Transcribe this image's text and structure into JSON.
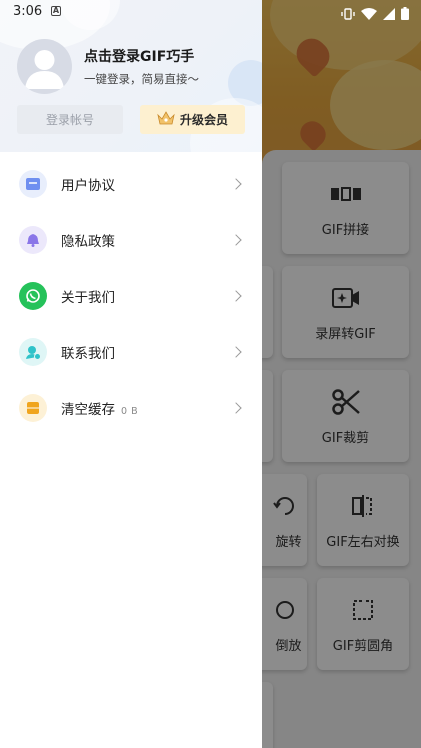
{
  "status_bar": {
    "time": "3:06",
    "icons": [
      "notification-a-icon",
      "vibrate-icon",
      "wifi-icon",
      "signal-icon",
      "battery-icon"
    ]
  },
  "drawer": {
    "profile": {
      "name": "点击登录GIF巧手",
      "subtitle": "一键登录，简易直接～",
      "login_label": "登录帐号",
      "vip_label": "升级会员"
    },
    "menu": [
      {
        "label": "用户协议",
        "icon": "document-icon",
        "extra": "",
        "color": "#6f8ff0",
        "bg": "#e8eefc"
      },
      {
        "label": "隐私政策",
        "icon": "bell-icon",
        "extra": "",
        "color": "#8a76e8",
        "bg": "#ece8fb"
      },
      {
        "label": "关于我们",
        "icon": "whatsapp-icon",
        "extra": "",
        "color": "#ffffff",
        "bg": "#25c25a"
      },
      {
        "label": "联系我们",
        "icon": "contact-icon",
        "extra": "",
        "color": "#2fc3c9",
        "bg": "#dff6f6"
      },
      {
        "label": "清空缓存",
        "icon": "trash-icon",
        "extra": "0 B",
        "color": "#f0a51e",
        "bg": "#fdf1d6"
      }
    ]
  },
  "background_app": {
    "tools": [
      {
        "label": "GIF拼接",
        "icon": "merge-icon"
      },
      {
        "label": "录屏转GIF",
        "icon": "screen-record-icon"
      },
      {
        "label": "GIF裁剪",
        "icon": "scissors-icon"
      },
      {
        "label": "旋转",
        "icon": "rotate-icon"
      },
      {
        "label": "GIF左右对换",
        "icon": "flip-horizontal-icon"
      },
      {
        "label": "倒放",
        "icon": "reverse-icon"
      },
      {
        "label": "GIF剪圆角",
        "icon": "round-corner-icon"
      }
    ]
  },
  "colors": {
    "vip_bg": "#fdf0d0",
    "login_bg": "#e8ebf0",
    "header_bg": "#eef2f8",
    "bg_accent": "#f2c055"
  }
}
